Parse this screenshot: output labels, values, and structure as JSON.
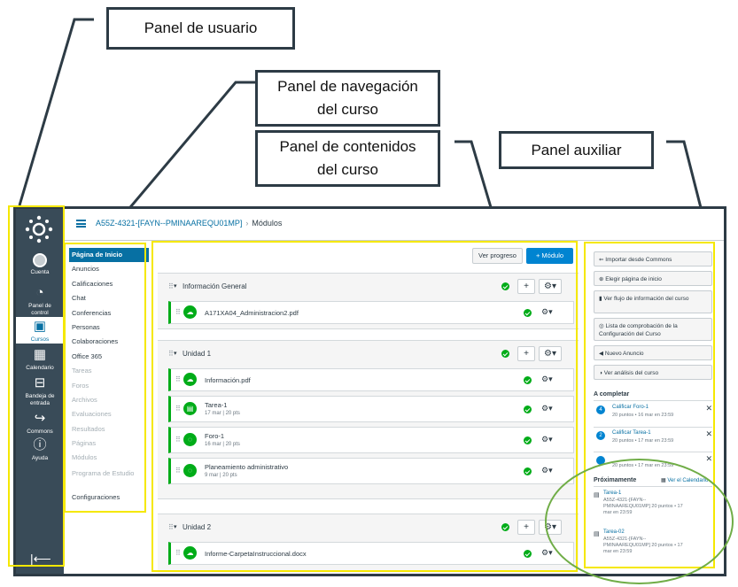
{
  "callouts": {
    "user_panel": "Panel de usuario",
    "nav_panel_l1": "Panel de navegación",
    "nav_panel_l2": "del curso",
    "content_panel_l1": "Panel de contenidos",
    "content_panel_l2": "del curso",
    "aux_panel": "Panel auxiliar"
  },
  "global_nav": {
    "items": [
      {
        "label": "Cuenta",
        "icon": "account-icon"
      },
      {
        "label": "Panel de control",
        "icon": "dashboard-icon"
      },
      {
        "label": "Cursos",
        "icon": "courses-icon"
      },
      {
        "label": "Calendario",
        "icon": "calendar-icon"
      },
      {
        "label": "Bandeja de entrada",
        "icon": "inbox-icon"
      },
      {
        "label": "Commons",
        "icon": "commons-icon"
      },
      {
        "label": "Ayuda",
        "icon": "help-icon"
      }
    ],
    "active": "Cursos"
  },
  "header": {
    "course": "A55Z-4321-[FAYN--PMINAAREQU01MP]",
    "separator": "›",
    "current": "Módulos"
  },
  "course_nav": {
    "items": [
      {
        "label": "Página de Inicio",
        "state": "active"
      },
      {
        "label": "Anuncios",
        "state": "normal"
      },
      {
        "label": "Calificaciones",
        "state": "normal"
      },
      {
        "label": "Chat",
        "state": "normal"
      },
      {
        "label": "Conferencias",
        "state": "normal"
      },
      {
        "label": "Personas",
        "state": "normal"
      },
      {
        "label": "Colaboraciones",
        "state": "normal"
      },
      {
        "label": "Office 365",
        "state": "normal"
      },
      {
        "label": "Tareas",
        "state": "disabled"
      },
      {
        "label": "Foros",
        "state": "disabled"
      },
      {
        "label": "Archivos",
        "state": "disabled"
      },
      {
        "label": "Evaluaciones",
        "state": "disabled"
      },
      {
        "label": "Resultados",
        "state": "disabled"
      },
      {
        "label": "Páginas",
        "state": "disabled"
      },
      {
        "label": "Módulos",
        "state": "disabled"
      },
      {
        "label": "Programa de Estudio",
        "state": "disabled"
      },
      {
        "label": "Configuraciones",
        "state": "normal"
      }
    ]
  },
  "content": {
    "progress_button": "Ver progreso",
    "add_module_button": "+ Módulo",
    "modules": [
      {
        "title": "Información General",
        "items": [
          {
            "title": "A171XA04_Administracion2.pdf",
            "sub": ""
          }
        ]
      },
      {
        "title": "Unidad 1",
        "items": [
          {
            "title": "Información.pdf",
            "sub": ""
          },
          {
            "title": "Tarea-1",
            "sub": "17 mar | 20 pts"
          },
          {
            "title": "Foro-1",
            "sub": "16 mar | 20 pts"
          },
          {
            "title": "Planeamiento administrativo",
            "sub": "9 mar | 20 pts"
          }
        ]
      },
      {
        "title": "Unidad 2",
        "items": [
          {
            "title": "Informe-CarpetaInstruccional.docx",
            "sub": ""
          }
        ]
      }
    ]
  },
  "aux": {
    "buttons": [
      "Importar desde Commons",
      "Elegir página de inicio",
      "Ver flujo de información del curso",
      "Lista de comprobación de la Configuración del Curso",
      "Nuevo Anuncio",
      "Ver análisis del curso"
    ],
    "todo_heading": "A completar",
    "todo": [
      {
        "num": "4",
        "title": "Calificar Foro-1",
        "sub": "20 puntos • 16 mar en 23:59"
      },
      {
        "num": "2",
        "title": "Calificar Tarea-1",
        "sub": "20 puntos • 17 mar en 23:59"
      },
      {
        "num": "",
        "title": "",
        "sub": "20 puntos • 17 mar en 23:59"
      }
    ],
    "upcoming_heading": "Próximamente",
    "calendar_link": "Ver el Calendario",
    "upcoming": [
      {
        "title": "Tarea-1",
        "sub": "A55Z-4321-[FAYN--PMINAAREQU01MP] 20 puntos • 17 mar en 23:59"
      },
      {
        "title": "Tarea-02",
        "sub": "A55Z-4321-[FAYN--PMINAAREQU01MP] 20 puntos • 17 mar en 23:59"
      }
    ]
  },
  "colors": {
    "accent": "#0770a3",
    "nav_bg": "#394b58",
    "published": "#00ac18",
    "highlight": "#f5e800",
    "ellipse": "#70ad47"
  }
}
